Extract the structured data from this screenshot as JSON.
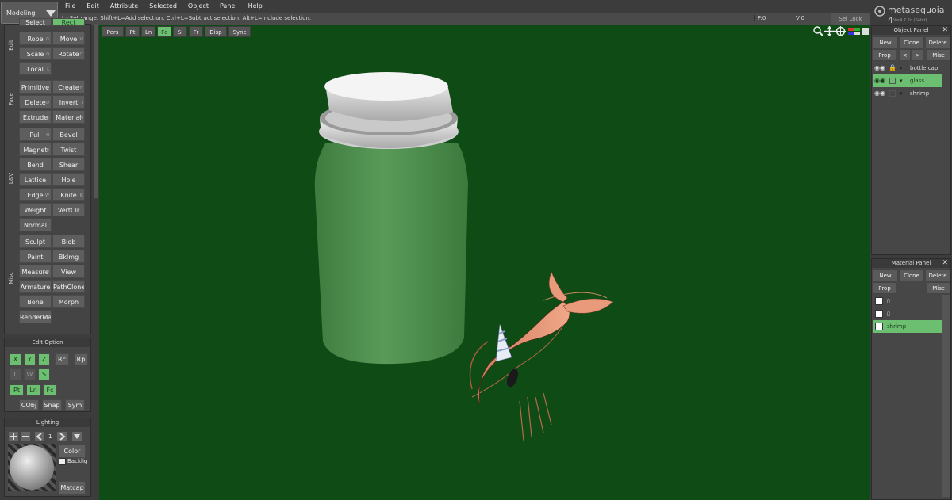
{
  "mode": {
    "label": "Modeling"
  },
  "menu": [
    "File",
    "Edit",
    "Attribute",
    "Selected",
    "Object",
    "Panel",
    "Help"
  ],
  "status": {
    "hint": "L=Set range.  Shift+L=Add selection.  Ctrl+L=Subtract selection.  Alt+L=Include selection.",
    "f": "F:0",
    "v": "V:0",
    "sel_lock": "Sel Lock"
  },
  "brand": {
    "name": "metasequoia 4",
    "version": "Ver4.7.2d (64bit)"
  },
  "view_tabs": [
    {
      "label": "Pers",
      "active": false
    },
    {
      "label": "Pt",
      "active": false
    },
    {
      "label": "Ln",
      "active": false
    },
    {
      "label": "Fc",
      "active": true
    },
    {
      "label": "Si",
      "active": false
    },
    {
      "label": "Fr",
      "active": false
    },
    {
      "label": "Disp",
      "active": false
    },
    {
      "label": "Sync",
      "active": false
    }
  ],
  "tools": {
    "edit_label": "Edit",
    "edit": [
      {
        "label": "Select",
        "active": false
      },
      {
        "label": "Rect",
        "active": true
      },
      {
        "label": "Rope",
        "key": "G"
      },
      {
        "label": "Move",
        "key": "V"
      },
      {
        "label": "Scale",
        "key": "Q"
      },
      {
        "label": "Rotate",
        "key": "C"
      },
      {
        "label": "Local",
        "key": "L"
      }
    ],
    "face_label": "Face",
    "face": [
      {
        "label": "Primitive",
        "key": "P"
      },
      {
        "label": "Create",
        "key": "F"
      },
      {
        "label": "Delete",
        "key": "D"
      },
      {
        "label": "Invert",
        "key": "I"
      },
      {
        "label": "Extrude",
        "key": "E"
      },
      {
        "label": "Material",
        "key": "M"
      }
    ],
    "lbv_label": "L&V",
    "lbv": [
      {
        "label": "Pull",
        "key": "H"
      },
      {
        "label": "Bevel"
      },
      {
        "label": "Magnet",
        "key": "B"
      },
      {
        "label": "Twist"
      },
      {
        "label": "Bend"
      },
      {
        "label": "Shear"
      },
      {
        "label": "Lattice"
      },
      {
        "label": "Hole"
      },
      {
        "label": "Edge",
        "key": "W"
      },
      {
        "label": "Knife",
        "key": "K"
      },
      {
        "label": "Weight"
      },
      {
        "label": "VertClr"
      },
      {
        "label": "Normal"
      }
    ],
    "misc_label": "Misc",
    "misc": [
      {
        "label": "Sculpt"
      },
      {
        "label": "Blob"
      },
      {
        "label": "Paint"
      },
      {
        "label": "BkImg"
      },
      {
        "label": "Measure",
        "key": "CB:V"
      },
      {
        "label": "View"
      },
      {
        "label": "Armature"
      },
      {
        "label": "PathClone"
      },
      {
        "label": "Bone"
      },
      {
        "label": "Morph"
      },
      {
        "label": "RenderMan"
      }
    ]
  },
  "edit_option": {
    "title": "Edit Option",
    "row1": [
      "X",
      "Y",
      "Z",
      "Rc",
      "Rp"
    ],
    "row2": [
      "L",
      "W",
      "S"
    ],
    "row3": [
      "Pt",
      "Ln",
      "Fc"
    ],
    "row4": [
      "CObj",
      "Snap",
      "Sym"
    ]
  },
  "lighting": {
    "title": "Lighting",
    "count": "1",
    "color": "Color",
    "backlight": "Backlig",
    "matcap": "Matcap"
  },
  "object_panel": {
    "title": "Object Panel",
    "new": "New",
    "clone": "Clone",
    "delete": "Delete",
    "prop": "Prop",
    "prev": "<",
    "next": ">",
    "misc": "Misc",
    "items": [
      {
        "name": "bottle cap",
        "selected": false
      },
      {
        "name": "glass",
        "selected": true
      },
      {
        "name": "shrimp",
        "selected": false
      }
    ]
  },
  "material_panel": {
    "title": "Material Panel",
    "new": "New",
    "clone": "Clone",
    "delete": "Delete",
    "prop": "Prop",
    "misc": "Misc",
    "items": [
      {
        "name": "▯",
        "selected": false
      },
      {
        "name": "▯",
        "selected": false
      },
      {
        "name": "shrimp",
        "selected": true
      }
    ]
  },
  "colors": {
    "viewport": "#0f4b14",
    "accent": "#6cbe70",
    "panel": "#474747"
  }
}
